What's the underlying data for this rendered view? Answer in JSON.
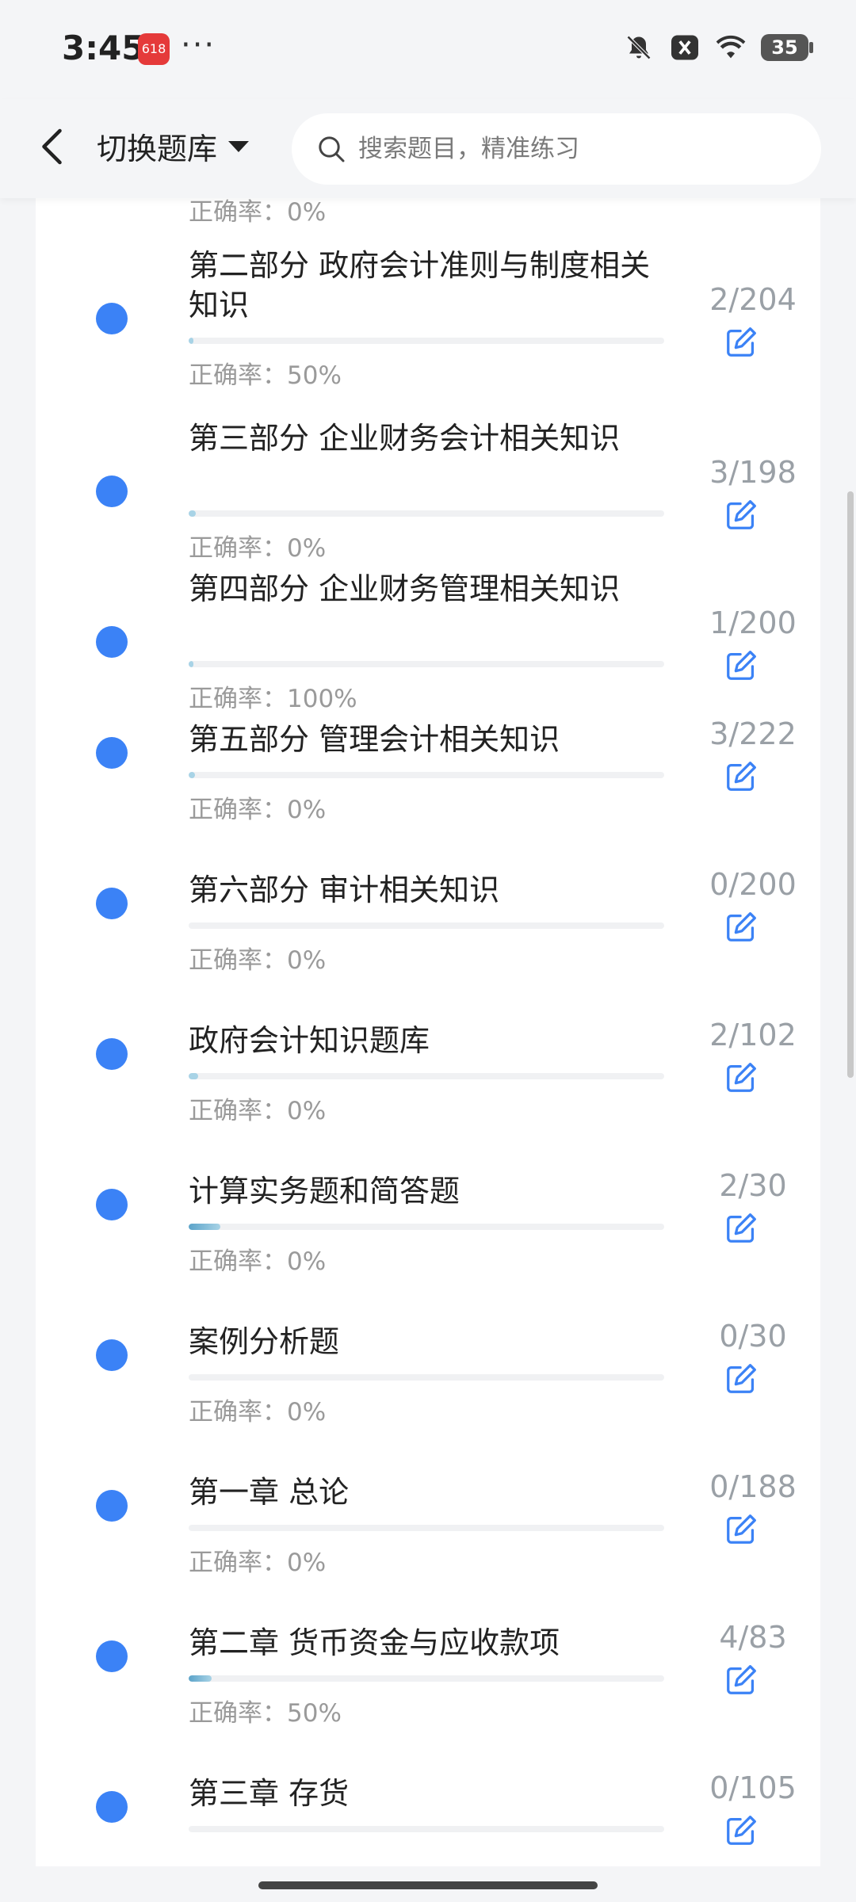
{
  "status_bar": {
    "time": "3:45",
    "app_badge": "618",
    "more": "···",
    "battery": "35"
  },
  "header": {
    "switch_label": "切换题库",
    "search_placeholder": "搜索题目，精准练习"
  },
  "accuracy_prefix": "正确率：",
  "top_partial": {
    "accuracy": "正确率：0%"
  },
  "items": [
    {
      "title": "第二部分 政府会计准则与制度相关知识",
      "accuracy": "正确率：50%",
      "count": "2/204",
      "progress": 0.0098
    },
    {
      "title": "第三部分 企业财务会计相关知识",
      "accuracy": "正确率：0%",
      "count": "3/198",
      "progress": 0.0152
    },
    {
      "title": "第四部分 企业财务管理相关知识",
      "accuracy": "正确率：100%",
      "count": "1/200",
      "progress": 0.005
    },
    {
      "title": "第五部分 管理会计相关知识",
      "accuracy": "正确率：0%",
      "count": "3/222",
      "progress": 0.0135
    },
    {
      "title": "第六部分 审计相关知识",
      "accuracy": "正确率：0%",
      "count": "0/200",
      "progress": 0
    },
    {
      "title": "政府会计知识题库",
      "accuracy": "正确率：0%",
      "count": "2/102",
      "progress": 0.0196
    },
    {
      "title": "计算实务题和简答题",
      "accuracy": "正确率：0%",
      "count": "2/30",
      "progress": 0.0667
    },
    {
      "title": "案例分析题",
      "accuracy": "正确率：0%",
      "count": "0/30",
      "progress": 0
    },
    {
      "title": "第一章 总论",
      "accuracy": "正确率：0%",
      "count": "0/188",
      "progress": 0
    },
    {
      "title": "第二章 货币资金与应收款项",
      "accuracy": "正确率：50%",
      "count": "4/83",
      "progress": 0.0482
    },
    {
      "title": "第三章 存货",
      "accuracy": "",
      "count": "0/105",
      "progress": 0
    }
  ],
  "colors": {
    "dot": "#3b82f6",
    "edit_icon": "#3b82f6",
    "progress_fill": "#a8d3e6",
    "count_text": "#9aa0a6"
  },
  "icons": {
    "back": "chevron-left-icon",
    "caret": "caret-down-icon",
    "search": "search-icon",
    "edit": "edit-icon"
  }
}
